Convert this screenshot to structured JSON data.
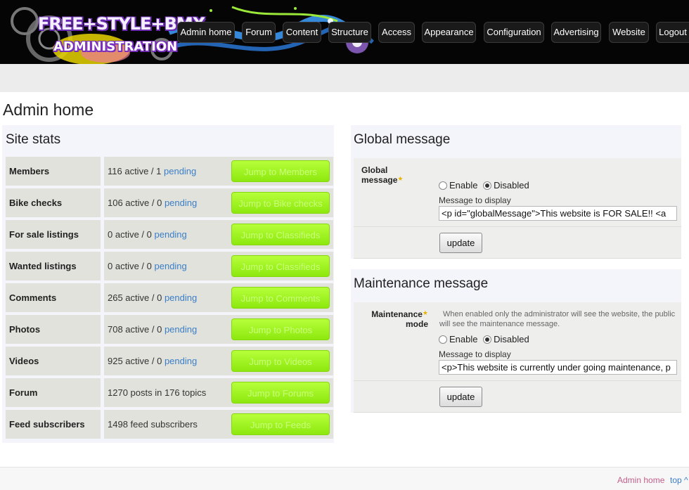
{
  "header": {
    "logo_line1": "FREE+STYLE+BMX",
    "logo_line2": "ADMINISTRATION",
    "nav": [
      {
        "label": "Admin home"
      },
      {
        "label": "Forum"
      },
      {
        "label": "Content"
      },
      {
        "label": "Structure"
      },
      {
        "label": "Access"
      },
      {
        "label": "Appearance"
      },
      {
        "label": "Configuration"
      },
      {
        "label": "Advertising"
      },
      {
        "label": "Website"
      },
      {
        "label": "Logout"
      }
    ]
  },
  "page_title": "Admin home",
  "stats": {
    "title": "Site stats",
    "rows": [
      {
        "label": "Members",
        "active": "116 active / 1",
        "pending": "pending",
        "button": "Jump to Members"
      },
      {
        "label": "Bike checks",
        "active": "106 active / 0",
        "pending": "pending",
        "button": "Jump to Bike checks"
      },
      {
        "label": "For sale listings",
        "active": "0 active / 0",
        "pending": "pending",
        "button": "Jump to Classifieds"
      },
      {
        "label": "Wanted listings",
        "active": "0 active / 0",
        "pending": "pending",
        "button": "Jump to Classifieds"
      },
      {
        "label": "Comments",
        "active": "265 active / 0",
        "pending": "pending",
        "button": "Jump to Comments"
      },
      {
        "label": "Photos",
        "active": "708 active / 0",
        "pending": "pending",
        "button": "Jump to Photos"
      },
      {
        "label": "Videos",
        "active": "925 active / 0",
        "pending": "pending",
        "button": "Jump to Videos"
      },
      {
        "label": "Forum",
        "active": "1270 posts in 176 topics",
        "pending": "",
        "button": "Jump to Forums"
      },
      {
        "label": "Feed subscribers",
        "active": "1498 feed subscribers",
        "pending": "",
        "button": "Jump to Feeds"
      }
    ]
  },
  "global": {
    "title": "Global message",
    "field_label": "Global message",
    "enable_label": "Enable",
    "disabled_label": "Disabled",
    "selected": "Disabled",
    "message_label": "Message to display",
    "message_value": "<p id=\"globalMessage\">This website is FOR SALE!! <a",
    "update_label": "update"
  },
  "maintenance": {
    "title": "Maintenance message",
    "field_label_1": "Maintenance",
    "field_label_2": "mode",
    "help": "When enabled only the administrator will see the website, the public will see the maintenance message.",
    "enable_label": "Enable",
    "disabled_label": "Disabled",
    "selected": "Disabled",
    "message_label": "Message to display",
    "message_value": "<p>This website is currently under going maintenance, p",
    "update_label": "update"
  },
  "footer": {
    "admin_home": "Admin home",
    "top": "top ^"
  },
  "colors": {
    "header_bg": "#050505",
    "jump_button": "#9ef21a",
    "link": "#3a7ec8",
    "footer_link": "#c0608a"
  }
}
